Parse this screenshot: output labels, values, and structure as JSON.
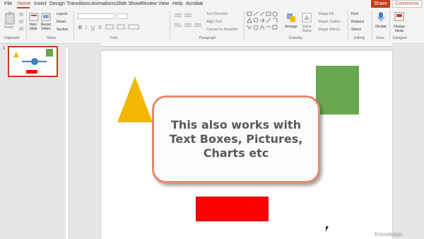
{
  "menu": {
    "tabs": [
      {
        "label": "File"
      },
      {
        "label": "Home"
      },
      {
        "label": "Insert"
      },
      {
        "label": "Design"
      },
      {
        "label": "Transitions"
      },
      {
        "label": "Animations"
      },
      {
        "label": "Slide Show"
      },
      {
        "label": "Review"
      },
      {
        "label": "View"
      },
      {
        "label": "Help"
      },
      {
        "label": "Acrobat"
      }
    ],
    "active_tab": "Home",
    "share_label": "Share",
    "comments_label": "Comments"
  },
  "ribbon": {
    "clipboard": {
      "paste": "Paste",
      "group": "Clipboard"
    },
    "slides": {
      "new_slide": "New Slide",
      "reuse_slides": "Reuse Slides",
      "layout": "Layout",
      "reset": "Reset",
      "section": "Section",
      "group": "Slides"
    },
    "font": {
      "group": "Font"
    },
    "paragraph": {
      "text_direction": "Text Direction",
      "align_text": "Align Text",
      "convert_smartart": "Convert to SmartArt",
      "group": "Paragraph"
    },
    "drawing": {
      "arrange": "Arrange",
      "quick_styles": "Quick Styles",
      "shape_fill": "Shape Fill",
      "shape_outline": "Shape Outline",
      "shape_effects": "Shape Effects",
      "group": "Drawing"
    },
    "editing": {
      "find": "Find",
      "replace": "Replace",
      "select": "Select",
      "group": "Editing"
    },
    "voice": {
      "dictate": "Dictate",
      "group": "Voice"
    },
    "designer": {
      "design_ideas": "Design Ideas",
      "group": "Designer"
    }
  },
  "thumbnail": {
    "number": "1"
  },
  "slide": {
    "callout_text": "This also works with\nText Boxes, Pictures,\nCharts etc"
  },
  "watermark": "Knowledge",
  "colors": {
    "accent": "#c43e1c",
    "triangle": "#f2b705",
    "square": "#6aa84f",
    "rectangle": "#ff0000",
    "callout_border": "#e48a6b",
    "callout_text": "#595959"
  }
}
